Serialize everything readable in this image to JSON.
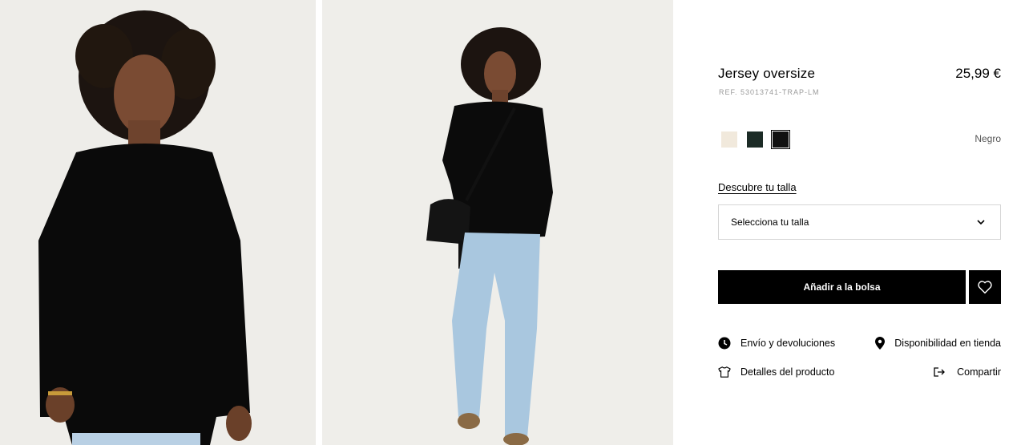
{
  "product": {
    "title": "Jersey oversize",
    "price": "25,99 €",
    "reference": "REF. 53013741-TRAP-LM"
  },
  "colors": {
    "selected_name": "Negro",
    "swatches": [
      {
        "name": "cream-swatch",
        "hex": "#f1e9dc"
      },
      {
        "name": "dark-green-swatch",
        "hex": "#1c2b26"
      },
      {
        "name": "black-swatch",
        "hex": "#111111"
      }
    ]
  },
  "size": {
    "guide_label": "Descubre tu talla",
    "select_placeholder": "Selecciona tu talla"
  },
  "actions": {
    "add_to_bag": "Añadir a la bolsa"
  },
  "links": {
    "shipping": "Envío y devoluciones",
    "store_availability": "Disponibilidad en tienda",
    "product_details": "Detalles del producto",
    "share": "Compartir"
  },
  "icons": {
    "shipping": "clock-icon",
    "store": "location-pin-icon",
    "details": "tshirt-icon",
    "share": "share-icon",
    "favorite": "heart-icon",
    "select": "chevron-down-icon"
  }
}
